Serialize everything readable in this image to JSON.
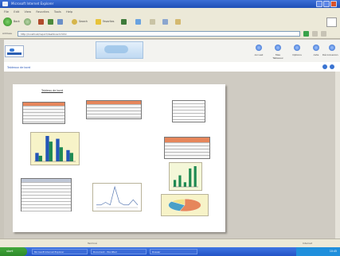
{
  "window": {
    "title": "Microsoft Internet Explorer"
  },
  "menu": [
    "File",
    "Edit",
    "View",
    "Favorites",
    "Tools",
    "Help"
  ],
  "toolbar": {
    "back_label": "Back",
    "search_label": "Search",
    "favorites_label": "Favorites"
  },
  "address": {
    "label": "Address",
    "url": "http://localhost/report/dashboard.html"
  },
  "app": {
    "nav": [
      "Accueil",
      "Mes Tableaux",
      "Options",
      "Aide",
      "Déconnexion"
    ],
    "breadcrumb": "Tableaux de bord"
  },
  "report": {
    "title": "Tableau de bord"
  },
  "status": {
    "left": "Terminé",
    "right": "Internet"
  },
  "taskbar": {
    "start": "start",
    "tasks": [
      "Microsoft Internet Explorer",
      "Document - WordPad",
      "Dossier"
    ],
    "clock": "10:45"
  },
  "chart_data": [
    {
      "type": "bar",
      "categories": [
        "1",
        "2",
        "3",
        "4"
      ],
      "series": [
        {
          "name": "",
          "values": [
            3,
            9,
            8,
            4
          ]
        },
        {
          "name": "",
          "values": [
            2,
            7,
            5,
            3
          ]
        }
      ],
      "colors": [
        "#2455b8",
        "#1e8a52"
      ],
      "grid": false
    },
    {
      "type": "bar",
      "categories": [
        "1",
        "2",
        "3",
        "4",
        "5"
      ],
      "series": [
        {
          "name": "",
          "values": [
            3,
            5,
            2,
            8,
            9
          ]
        }
      ],
      "colors": [
        "#1e8a52",
        "#2455b8"
      ],
      "grid": false
    },
    {
      "type": "line",
      "x": [
        1,
        2,
        3,
        4,
        5,
        6,
        7,
        8,
        9,
        10
      ],
      "series": [
        {
          "name": "",
          "values": [
            1,
            1,
            2,
            1,
            8,
            2,
            1,
            1,
            3,
            1
          ]
        }
      ],
      "colors": [
        "#5b7bb3"
      ]
    },
    {
      "type": "pie",
      "categories": [
        "a",
        "b",
        "c"
      ],
      "values": [
        55,
        30,
        15
      ],
      "colors": [
        "#e6865b",
        "#4aa0c8",
        "#f1e28a"
      ]
    }
  ],
  "colors": {
    "accent": "#2f66c9",
    "table_header": "#e6865b"
  }
}
